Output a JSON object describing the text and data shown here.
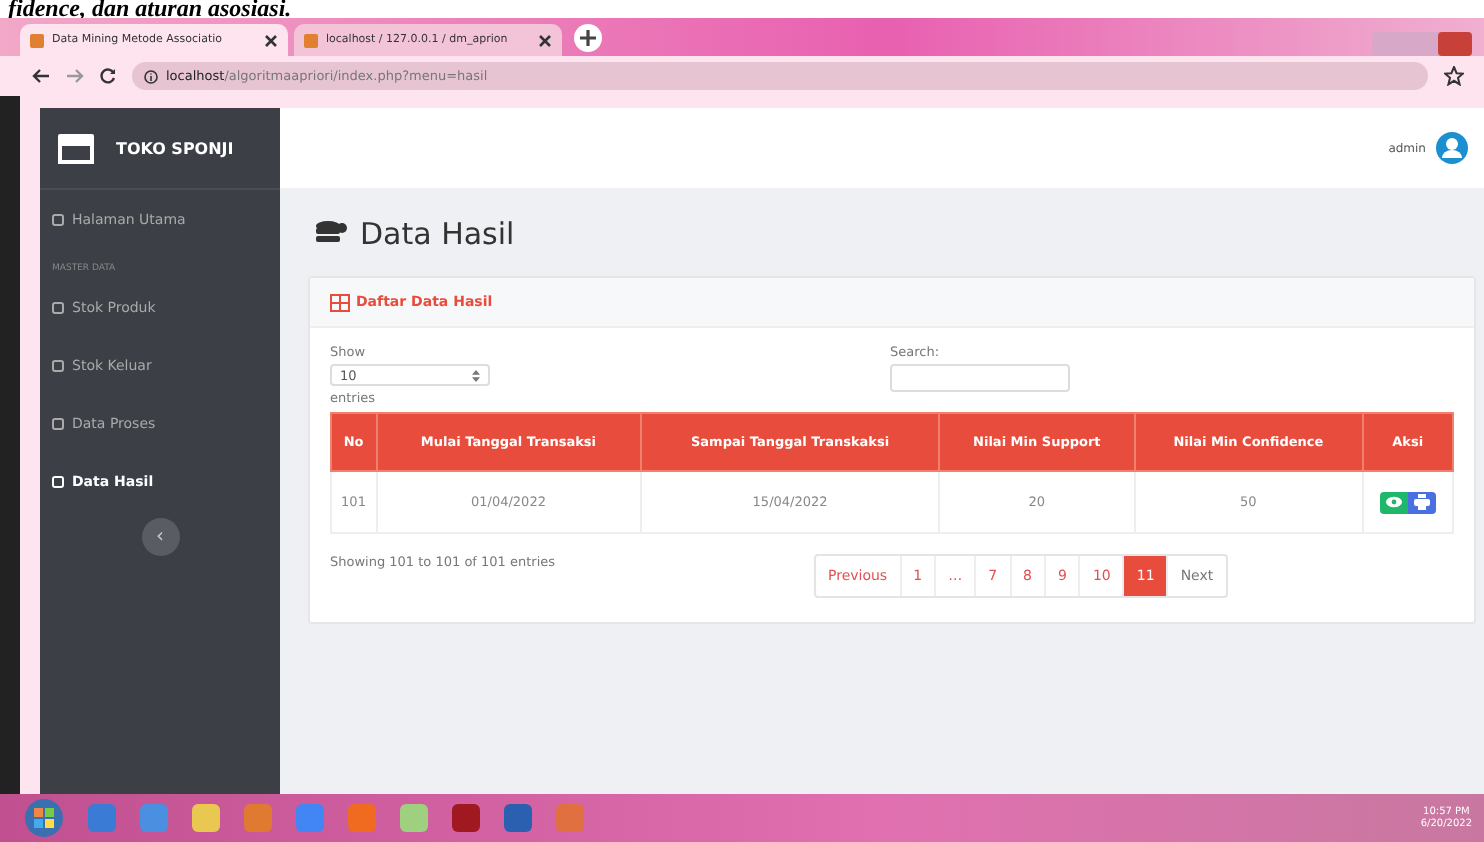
{
  "document_caption": "fidence, dan aturan asosiasi.",
  "browser": {
    "tabs": [
      {
        "label": "Data Mining Metode Associatio",
        "selected": true
      },
      {
        "label": "localhost / 127.0.0.1 / dm_aprion",
        "selected": false
      }
    ],
    "url_host": "localhost",
    "url_path": "/algoritmaapriori/index.php?menu=hasil"
  },
  "sidebar": {
    "brand": "TOKO SPONJI",
    "items": [
      {
        "kind": "item",
        "label": "Halaman Utama",
        "selected": false
      },
      {
        "kind": "section",
        "label": "MASTER DATA"
      },
      {
        "kind": "item",
        "label": "Stok Produk",
        "selected": false
      },
      {
        "kind": "item",
        "label": "Stok Keluar",
        "selected": false
      },
      {
        "kind": "item",
        "label": "Data Proses",
        "selected": false
      },
      {
        "kind": "item",
        "label": "Data Hasil",
        "selected": true
      }
    ],
    "collapse": "‹"
  },
  "header": {
    "user": "admin"
  },
  "page_title": "Data Hasil",
  "card": {
    "title": "Daftar Data Hasil",
    "show_label": "Show",
    "page_size": "10",
    "entries_label": "entries",
    "search_label": "Search:",
    "table": {
      "columns": [
        "No",
        "Mulai Tanggal Transaksi",
        "Sampai Tanggal Transkaksi",
        "Nilai Min Support",
        "Nilai Min Confidence",
        "Aksi"
      ],
      "rows": [
        [
          "101",
          "01/04/2022",
          "15/04/2022",
          "20",
          "50"
        ]
      ]
    },
    "info": "Showing 101 to 101 of 101 entries",
    "pagination": [
      {
        "label": "Previous",
        "selected": false
      },
      {
        "label": "1",
        "selected": false
      },
      {
        "label": "…",
        "selected": false
      },
      {
        "label": "7",
        "selected": false
      },
      {
        "label": "8",
        "selected": false
      },
      {
        "label": "9",
        "selected": false
      },
      {
        "label": "10",
        "selected": false
      },
      {
        "label": "11",
        "selected": true
      },
      {
        "label": "Next",
        "selected": false
      }
    ]
  },
  "taskbar": {
    "time": "10:57 PM",
    "date": "6/20/2022"
  }
}
